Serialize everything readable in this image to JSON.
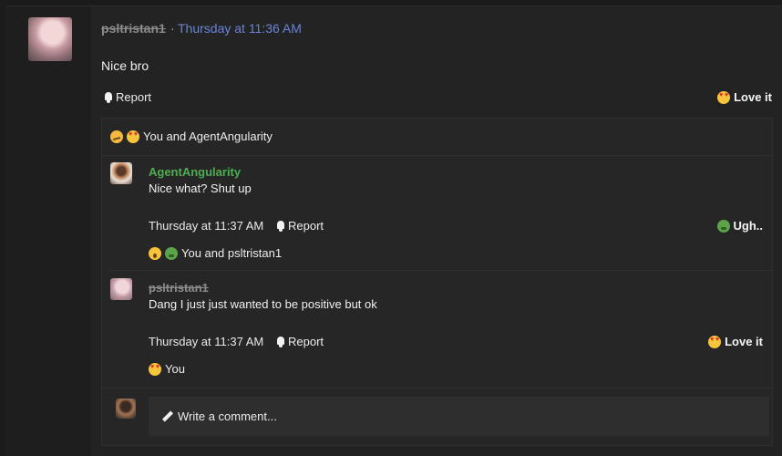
{
  "post": {
    "username": "psltristan1",
    "separator": "·",
    "timestamp": "Thursday at 11:36 AM",
    "text": "Nice bro",
    "report_label": "Report",
    "reaction_label": "Love it",
    "reaction_icon": "love-emoji"
  },
  "reactions_summary": {
    "icons": [
      "thinking-emoji",
      "love-emoji"
    ],
    "text": "You and AgentAngularity"
  },
  "comments": [
    {
      "username": "AgentAngularity",
      "username_color": "#4caf50",
      "text": "Nice what? Shut up",
      "timestamp": "Thursday at 11:37 AM",
      "report_label": "Report",
      "reaction_label": "Ugh..",
      "reaction_icon": "sick-emoji",
      "reactions_text": "You and psltristan1",
      "reactions_icons": [
        "wow-emoji",
        "sick-emoji"
      ]
    },
    {
      "username": "psltristan1",
      "text": "Dang I just just wanted to be positive but ok",
      "timestamp": "Thursday at 11:37 AM",
      "report_label": "Report",
      "reaction_label": "Love it",
      "reaction_icon": "love-emoji",
      "reactions_text": "You",
      "reactions_icons": [
        "love-emoji"
      ]
    }
  ],
  "composer": {
    "placeholder": "Write a comment..."
  }
}
